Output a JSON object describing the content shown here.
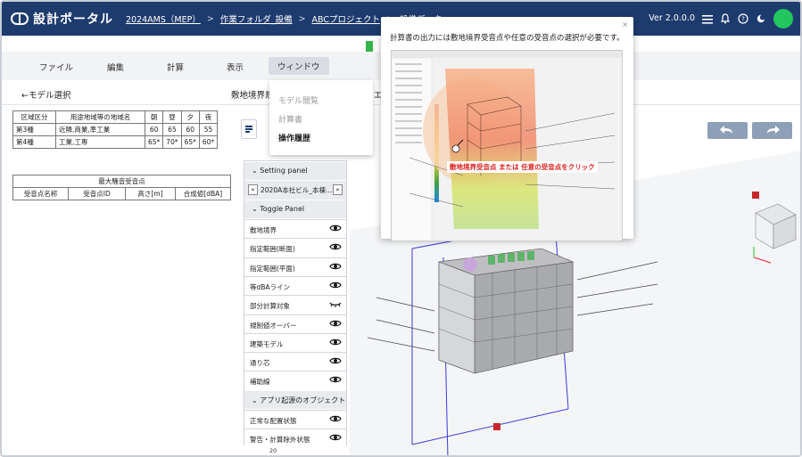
{
  "topbar": {
    "logo_text": "設計ポータル",
    "breadcrumbs": [
      "2024AMS（MEP）",
      "作業フォルダ_設備",
      "ABCプロジェクト",
      "設備データ"
    ],
    "version": "Ver 2.0.0.0"
  },
  "menu": {
    "items": [
      "ファイル",
      "編集",
      "計算",
      "表示",
      "ウィンドウ"
    ],
    "active": "ウィンドウ"
  },
  "dropdown": {
    "items": [
      "モデル閲覧",
      "計算書",
      "操作履歴"
    ],
    "current": "操作履歴"
  },
  "subheader": {
    "back_link": "←モデル選択",
    "title": "敷地境界規",
    "title_suffix": "エ"
  },
  "zone_table": {
    "headers": [
      "区域区分",
      "用途地域等の地域名",
      "朝",
      "昼",
      "夕",
      "夜"
    ],
    "rows": [
      [
        "第3種",
        "近隣,商業,準工業",
        "60",
        "65",
        "60",
        "55"
      ],
      [
        "第4種",
        "工業,工専",
        "65*",
        "70*",
        "65*",
        "60*"
      ]
    ]
  },
  "receiver_table": {
    "title": "最大騒音受音点",
    "headers": [
      "受音点名称",
      "受音点ID",
      "高さ[m]",
      "合成値[dBA]"
    ]
  },
  "panel": {
    "setting_header": "Setting panel",
    "selected_model": "2020A本社ビル_本棟…",
    "toggle_header": "Toggle Panel",
    "toggle_items": [
      "敷地境界",
      "指定範囲(断面)",
      "指定範囲(平面)",
      "等dBAライン",
      "部分計算対象",
      "規制値オーバー",
      "建築モデル",
      "通り芯",
      "補助線"
    ],
    "app_header": "アプリ起源のオブジェクト",
    "app_items": [
      "正常な配置状態",
      "警告・計算除外状態"
    ],
    "footer_number": "20"
  },
  "popup": {
    "message": "計算書の出力には敷地境界受音点や任意の受音点の選択が必要です。",
    "callout": "敷地境界受音点 または 任意の受音点をクリック",
    "close": "×"
  },
  "colors": {
    "topbar": "#1e3b6e",
    "avatar": "#22c55e",
    "accent_red": "#e01e1e",
    "nav_button": "#8da0b8"
  }
}
